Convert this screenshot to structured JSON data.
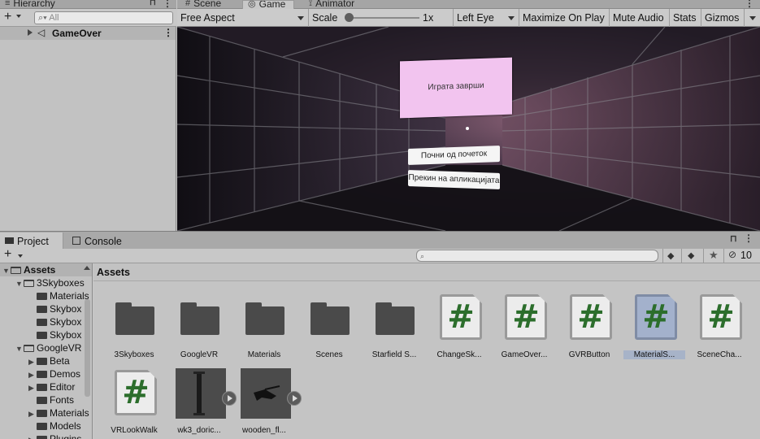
{
  "hierarchy": {
    "tab_label": "Hierarchy",
    "search_placeholder": "All",
    "scene_item": "GameOver"
  },
  "top_tabs": {
    "scene": "Scene",
    "game": "Game",
    "animator": "Animator"
  },
  "game_toolbar": {
    "aspect": "Free Aspect",
    "scale_label": "Scale",
    "scale_value": "1x",
    "scale_fraction": 0.0,
    "eye": "Left Eye",
    "maximize": "Maximize On Play",
    "mute": "Mute Audio",
    "stats": "Stats",
    "gizmos": "Gizmos"
  },
  "game_view": {
    "panel_title": "Играта заврши",
    "restart_button": "Почни од почеток",
    "exit_button": "Прекин на апликацијата",
    "panel_color": "#f2c4ef"
  },
  "project": {
    "tab_project": "Project",
    "tab_console": "Console",
    "hidden_count": "10",
    "path": "Assets",
    "tree": [
      {
        "label": "Assets",
        "depth": 0,
        "expanded": true,
        "bold": true
      },
      {
        "label": "3Skyboxes",
        "depth": 1,
        "expanded": true
      },
      {
        "label": "Materials",
        "depth": 2,
        "expanded": false
      },
      {
        "label": "Skybox",
        "depth": 2,
        "expanded": false
      },
      {
        "label": "Skybox",
        "depth": 2,
        "expanded": false
      },
      {
        "label": "Skybox",
        "depth": 2,
        "expanded": false
      },
      {
        "label": "GoogleVR",
        "depth": 1,
        "expanded": true
      },
      {
        "label": "Beta",
        "depth": 2,
        "expanded": false,
        "arrow": true
      },
      {
        "label": "Demos",
        "depth": 2,
        "expanded": false,
        "arrow": true
      },
      {
        "label": "Editor",
        "depth": 2,
        "expanded": false,
        "arrow": true
      },
      {
        "label": "Fonts",
        "depth": 2,
        "expanded": false
      },
      {
        "label": "Materials",
        "depth": 2,
        "expanded": false,
        "arrow": true
      },
      {
        "label": "Models",
        "depth": 2,
        "expanded": false
      },
      {
        "label": "Plugins",
        "depth": 2,
        "expanded": false,
        "arrow": true
      }
    ],
    "assets": [
      {
        "name": "3Skyboxes",
        "kind": "folder"
      },
      {
        "name": "GoogleVR",
        "kind": "folder"
      },
      {
        "name": "Materials",
        "kind": "folder"
      },
      {
        "name": "Scenes",
        "kind": "folder"
      },
      {
        "name": "Starfield S...",
        "kind": "folder"
      },
      {
        "name": "ChangeSk...",
        "kind": "script"
      },
      {
        "name": "GameOver...",
        "kind": "script"
      },
      {
        "name": "GVRButton",
        "kind": "script"
      },
      {
        "name": "MaterialS...",
        "kind": "script",
        "selected": true
      },
      {
        "name": "SceneCha...",
        "kind": "script"
      },
      {
        "name": "VRLookWalk",
        "kind": "script"
      },
      {
        "name": "wk3_doric...",
        "kind": "model"
      },
      {
        "name": "wooden_fl...",
        "kind": "model"
      }
    ]
  }
}
